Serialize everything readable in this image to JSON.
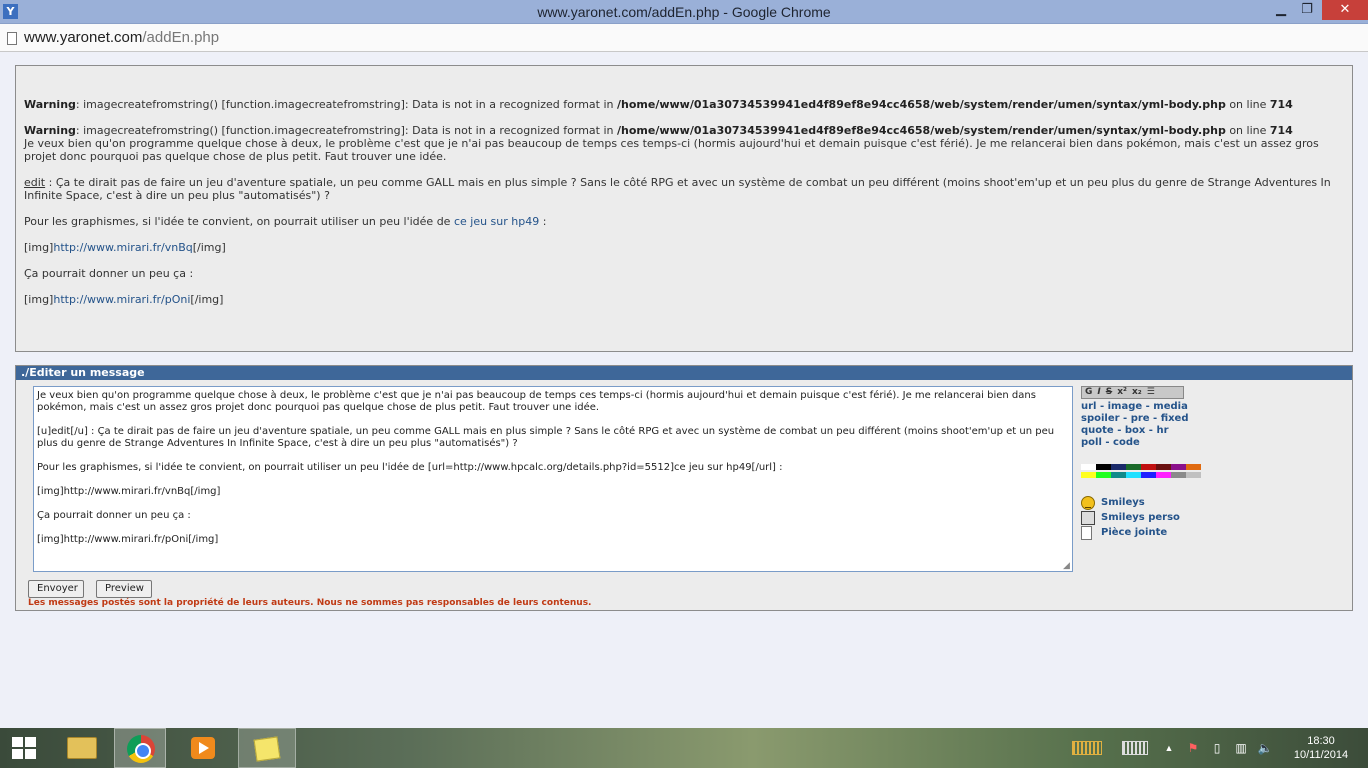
{
  "window": {
    "app_icon": "Y",
    "title": "www.yaronet.com/addEn.php - Google Chrome",
    "minimize_glyph": "▁",
    "maximize_glyph": "❐",
    "close_glyph": "✕"
  },
  "address": {
    "domain": "www.yaronet.com",
    "path": "/addEn.php"
  },
  "warnings": {
    "label": "Warning",
    "message": ": imagecreatefromstring() [function.imagecreatefromstring]: Data is not in a recognized format in ",
    "file": "/home/www/01a30734539941ed4f89ef8e94cc4658/web/system/render/umen/syntax/yml-body.php",
    "online": " on line ",
    "line": "714"
  },
  "preview": {
    "p1": "Je veux bien qu'on programme quelque chose à deux, le problème c'est que je n'ai pas beaucoup de temps ces temps-ci (hormis aujourd'hui et demain puisque c'est férié). Je me relancerai bien dans pokémon, mais c'est un assez gros projet donc pourquoi pas quelque chose de plus petit. Faut trouver une idée.",
    "edit_word": "edit",
    "p2": " : Ça te dirait pas de faire un jeu d'aventure spatiale, un peu comme GALL mais en plus simple ? Sans le côté RPG et avec un système de combat un peu différent (moins shoot'em'up et un peu plus du genre de Strange Adventures In Infinite Space, c'est à dire un peu plus \"automatisés\") ?",
    "p3_before": "Pour les graphismes, si l'idée te convient, on pourrait utiliser un peu l'idée de ",
    "p3_link": "ce jeu sur hp49",
    "p3_after": " :",
    "img1_open": "[img]",
    "img1_url": "http://www.mirari.fr/vnBq",
    "img1_close": "[/img]",
    "p4": "Ça pourrait donner un peu ça :",
    "img2_open": "[img]",
    "img2_url": "http://www.mirari.fr/pOni",
    "img2_close": "[/img]"
  },
  "editor": {
    "header": "./Editer un message",
    "text": "Je veux bien qu'on programme quelque chose à deux, le problème c'est que je n'ai pas beaucoup de temps ces temps-ci (hormis aujourd'hui et demain puisque c'est férié). Je me relancerai bien dans pokémon, mais c'est un assez gros projet donc pourquoi pas quelque chose de plus petit. Faut trouver une idée.\n\n[u]edit[/u] : Ça te dirait pas de faire un jeu d'aventure spatiale, un peu comme GALL mais en plus simple ? Sans le côté RPG et avec un système de combat un peu différent (moins shoot'em'up et un peu plus du genre de Strange Adventures In Infinite Space, c'est à dire un peu plus \"automatisés\") ?\n\nPour les graphismes, si l'idée te convient, on pourrait utiliser un peu l'idée de [url=http://www.hpcalc.org/details.php?id=5512]ce jeu sur hp49[/url] :\n\n[img]http://www.mirari.fr/vnBq[/img]\n\nÇa pourrait donner un peu ça :\n\n[img]http://www.mirari.fr/pOni[/img]",
    "toolbar": [
      "G",
      "I",
      "S",
      "x²",
      "x₂",
      "☰"
    ],
    "tags": {
      "row1": [
        "url",
        "image",
        "media"
      ],
      "row2": [
        "spoiler",
        "pre",
        "fixed"
      ],
      "row3": [
        "quote",
        "box",
        "hr"
      ],
      "row4": [
        "poll",
        "code"
      ],
      "sep": " - "
    },
    "palette_row1": [
      "#ffffff",
      "#000000",
      "#1a2a6a",
      "#1a6a2a",
      "#c01010",
      "#6a1010",
      "#8a108a",
      "#e06a10"
    ],
    "palette_row2": [
      "#ffff20",
      "#20ff20",
      "#108a8a",
      "#20e0ff",
      "#2020ff",
      "#ff20ff",
      "#8a8a8a",
      "#c0c0c0"
    ],
    "smileys": "Smileys",
    "smileys_perso": "Smileys perso",
    "piece_jointe": "Pièce jointe",
    "send": "Envoyer",
    "preview": "Preview",
    "notice": "Les messages postés sont la propriété de leurs auteurs. Nous ne sommes pas responsables de leurs contenus."
  },
  "tray": {
    "time": "18:30",
    "date": "10/11/2014",
    "up_arrow": "▲",
    "flag": "⚑",
    "volume": "🔈"
  }
}
